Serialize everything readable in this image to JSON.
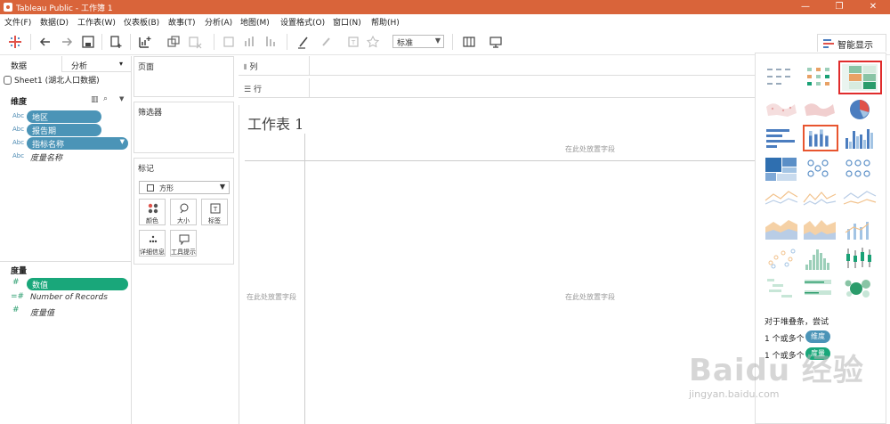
{
  "window": {
    "title": "Tableau Public - 工作簿 1"
  },
  "menu": [
    "文件(F)",
    "数据(D)",
    "工作表(W)",
    "仪表板(B)",
    "故事(T)",
    "分析(A)",
    "地图(M)",
    "设置格式(O)",
    "窗口(N)",
    "帮助(H)"
  ],
  "toolbar": {
    "zoom_value": "标准"
  },
  "showme_button": {
    "label": "智能显示"
  },
  "datapane": {
    "tab_data": "数据",
    "tab_analysis": "分析",
    "source": "Sheet1 (湖北人口数据)",
    "dimensions_header": "度量",
    "dimensions_title": "维度",
    "dimensions": [
      {
        "type": "Abc",
        "label": "地区",
        "pill": true
      },
      {
        "type": "Abc",
        "label": "报告期",
        "pill": true
      },
      {
        "type": "Abc",
        "label": "指标名称",
        "pill": true
      },
      {
        "type": "Abc",
        "label": "度量名称",
        "pill": false
      }
    ],
    "measures_title": "度量",
    "measures": [
      {
        "type": "#",
        "label": "数值",
        "pill": true
      },
      {
        "type": "=#",
        "label": "Number of Records",
        "pill": false
      },
      {
        "type": "#",
        "label": "度量值",
        "pill": false
      }
    ]
  },
  "shelves": {
    "pages": "页面",
    "filters": "筛选器",
    "marks": "标记",
    "mark_type": "方形",
    "columns": "列",
    "rows": "行",
    "mark_buttons": [
      "颜色",
      "大小",
      "标签",
      "详细信息",
      "工具提示"
    ]
  },
  "canvas": {
    "sheet_title": "工作表 1",
    "drop_top": "在此处放置字段",
    "drop_left": "在此处放置字段",
    "drop_center": "在此处放置字段"
  },
  "showme": {
    "hint_line1": "对于堆叠条，尝试",
    "hint_row1_prefix": "1 个或多个",
    "hint_row1_pill": "维度",
    "hint_row2_prefix": "1 个或多个",
    "hint_row2_pill": "度量"
  },
  "watermark": {
    "text": "Baidu 经验",
    "sub": "jingyan.baidu.com"
  },
  "colors": {
    "title_bar": "#d9643a",
    "dimension_pill": "#4b94b7",
    "measure_pill": "#19a77a",
    "selected_chart": "#e8552f",
    "highlight_frame": "#e02c2c"
  }
}
